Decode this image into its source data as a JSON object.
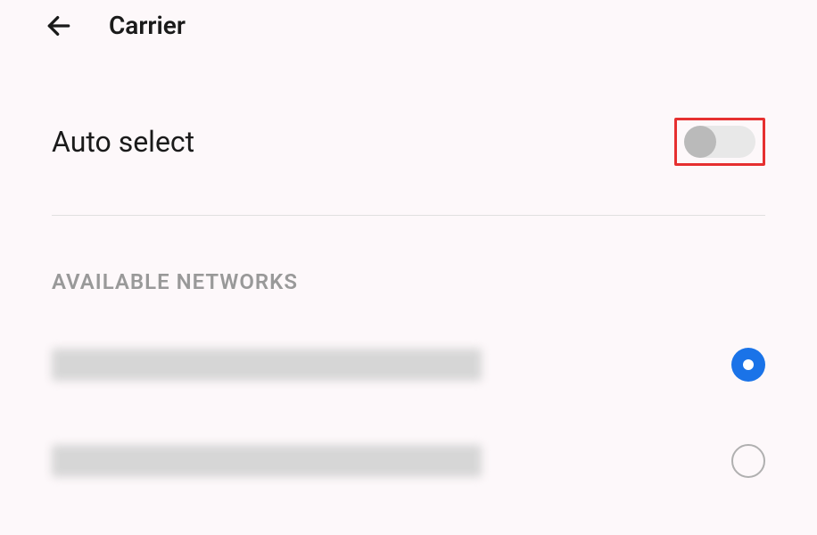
{
  "header": {
    "title": "Carrier"
  },
  "auto_select": {
    "label": "Auto select",
    "enabled": false
  },
  "section": {
    "header": "AVAILABLE NETWORKS"
  },
  "networks": [
    {
      "label": "",
      "selected": true
    },
    {
      "label": "",
      "selected": false
    }
  ],
  "highlight": {
    "color": "#e63030"
  }
}
